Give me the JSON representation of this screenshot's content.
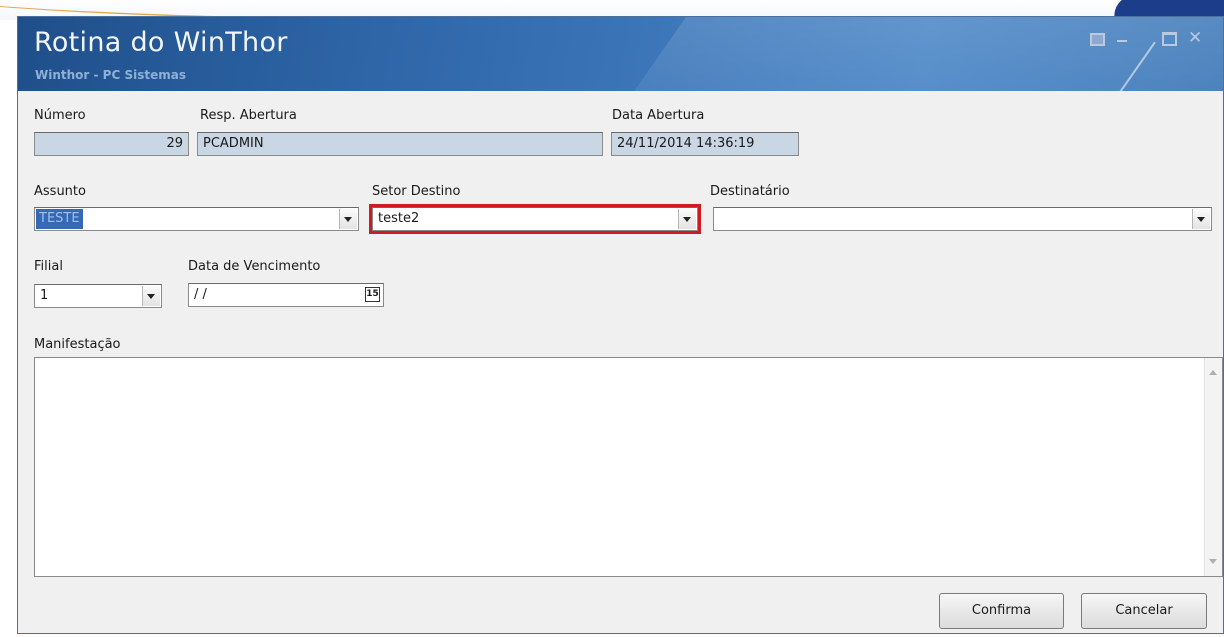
{
  "window": {
    "title": "Rotina do WinThor",
    "subtitle": "Winthor - PC Sistemas"
  },
  "form": {
    "numero": {
      "label": "Número",
      "value": "29"
    },
    "resp_abertura": {
      "label": "Resp. Abertura",
      "value": "PCADMIN"
    },
    "data_abertura": {
      "label": "Data Abertura",
      "value": "24/11/2014 14:36:19"
    },
    "assunto": {
      "label": "Assunto",
      "value": "TESTE"
    },
    "setor_destino": {
      "label": "Setor Destino",
      "value": "teste2"
    },
    "destinatario": {
      "label": "Destinatário",
      "value": ""
    },
    "filial": {
      "label": "Filial",
      "value": "1"
    },
    "data_vencimento": {
      "label": "Data de Vencimento",
      "value": "/ /",
      "calendar_glyph": "15"
    },
    "manifestacao": {
      "label": "Manifestação",
      "value": ""
    }
  },
  "buttons": {
    "confirm": "Confirma",
    "cancel": "Cancelar"
  },
  "colors": {
    "titlebar": "#2e66a8",
    "readonly_field": "#c9d6e3",
    "selection": "#3569b5",
    "highlight_border": "#d01a22"
  },
  "icons": [
    "restore-icon",
    "minimize-icon",
    "maximize-icon",
    "close-icon",
    "dropdown-arrow-icon",
    "calendar-icon"
  ]
}
